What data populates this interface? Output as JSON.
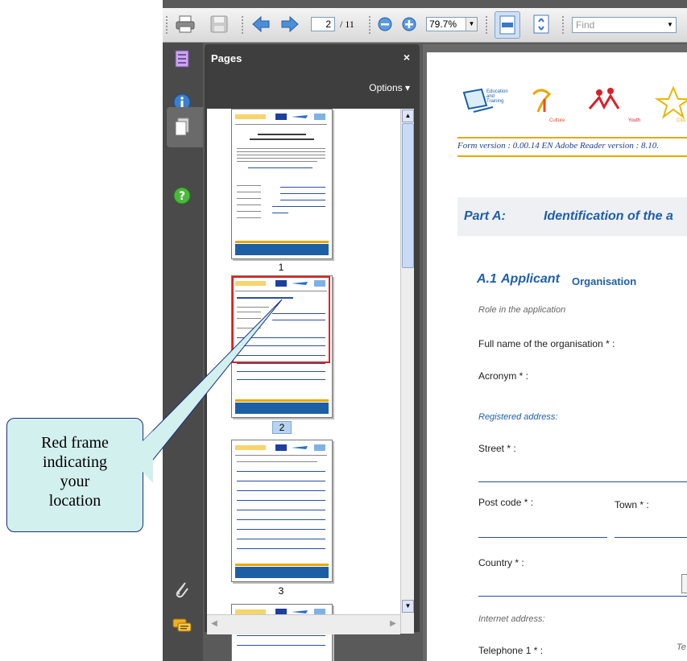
{
  "toolbar": {
    "current_page": "2",
    "total_pages": "/ 11",
    "zoom": "79.7%",
    "find_placeholder": "Find"
  },
  "pages_panel": {
    "title": "Pages",
    "close": "×",
    "options": "Options ▾",
    "thumbnails": [
      "1",
      "2",
      "3"
    ]
  },
  "callout": {
    "text": "Red frame\nindicating\nyour\nlocation"
  },
  "document": {
    "logo_labels": {
      "education": "Education\nand\nTraining",
      "culture": "Culture",
      "youth": "Youth",
      "citizens": "Citiz"
    },
    "form_version": "Form version : 0.00.14 EN  Adobe Reader version : 8.10.",
    "part_label": "Part A:",
    "part_title": "Identification of the a",
    "section_num": "A.1",
    "section_title": "Applicant",
    "section_subtitle": "Organisation",
    "role_label": "Role in the application",
    "full_name_label": "Full name of the organisation * :",
    "acronym_label": "Acronym * :",
    "registered_label": "Registered address:",
    "street_label": "Street * :",
    "postcode_label": "Post code * :",
    "town_label": "Town * :",
    "country_label": "Country * :",
    "internet_label": "Internet address:",
    "telephone_label": "Telephone 1 * :",
    "te_label": "Te"
  },
  "colors": {
    "accent_blue": "#1f5fa8",
    "thumb_highlight": "#e02020",
    "callout_fill": "#d2f0ee"
  }
}
